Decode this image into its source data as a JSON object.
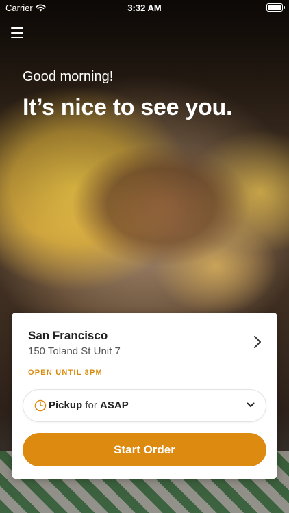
{
  "status_bar": {
    "carrier": "Carrier",
    "time": "3:32 AM"
  },
  "hero": {
    "greeting": "Good morning!",
    "headline": "It’s nice to see you."
  },
  "location_card": {
    "name": "San Francisco",
    "address": "150 Toland St Unit 7",
    "open_status": "OPEN UNTIL 8PM",
    "order_mode": "Pickup",
    "for_word": "for",
    "order_time": "ASAP",
    "start_button_label": "Start Order"
  },
  "colors": {
    "accent": "#dd8a10",
    "open_status": "#d98a0b"
  },
  "icons": {
    "menu": "hamburger-menu-icon",
    "wifi": "wifi-icon",
    "battery": "battery-icon",
    "chevron_right": "chevron-right-icon",
    "clock": "clock-icon",
    "chevron_down": "chevron-down-icon"
  }
}
